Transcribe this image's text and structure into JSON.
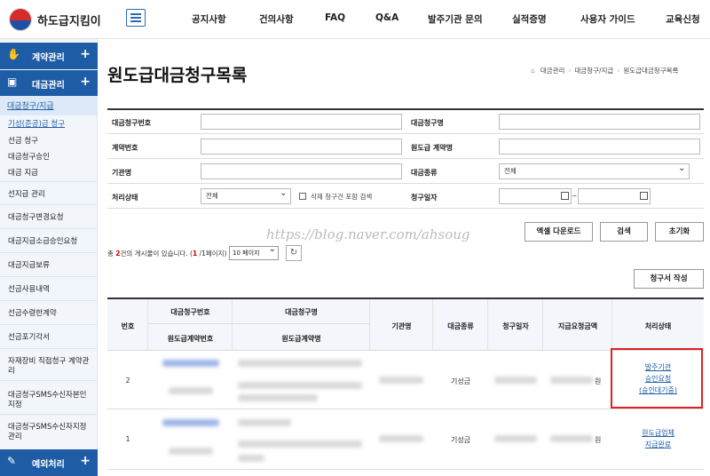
{
  "header": {
    "logo_text": "하도급지킴이",
    "nav": [
      "공지사항",
      "건의사항",
      "FAQ",
      "Q&A",
      "발주기관 문의",
      "실적증명",
      "사용자 가이드",
      "교육신청"
    ]
  },
  "sidebar": {
    "section1": "계약관리",
    "section2": "대금관리",
    "section3": "예외처리",
    "plus": "+",
    "sub_title": "대금청구/지급",
    "sub_items": [
      "기성(준공)금 청구",
      "선금 청구",
      "대금청구승인",
      "대금 지급"
    ],
    "menu_items": [
      "선지급 관리",
      "대금청구변경요청",
      "대금지급소급승인요청",
      "대금지급보류",
      "선금사용내역",
      "선금수령한계약",
      "선금포기각서",
      "자재장비 직접청구 계약관리",
      "대금청구SMS수신자본인지정",
      "대금청구SMS수신자지정관리"
    ]
  },
  "page": {
    "title": "원도급대금청구목록",
    "breadcrumb": [
      "대금관리",
      "대금청구/지급",
      "원도급대금청구목록"
    ]
  },
  "search": {
    "labels": [
      "대금청구번호",
      "대금청구명",
      "계약번호",
      "원도급 계약명",
      "기관명",
      "대금종류",
      "처리상태",
      "청구일자"
    ],
    "amount_type_value": "전체",
    "status_value": "전체",
    "include_deleted_label": "삭제 청구건 포함 검색",
    "date_sep": "~"
  },
  "buttons": {
    "excel": "엑셀 다운로드",
    "search": "검색",
    "reset": "초기화",
    "write": "청구서 작성"
  },
  "watermark": "https://blog.naver.com/ahsoug",
  "listinfo": {
    "prefix": "총 ",
    "count": "2",
    "middle": "건의 게시물이 있습니다. (",
    "page": "1",
    "suffix": " /1페이지)",
    "page_size": "10 페이지",
    "refresh_icon": "↻"
  },
  "table": {
    "headers": {
      "no": "번호",
      "claim_no": "대금청구번호",
      "contract_no": "원도급계약번호",
      "claim_name": "대금청구명",
      "contract_name": "원도급계약명",
      "org": "기관명",
      "type": "대금종류",
      "date": "청구일자",
      "amount": "지급요청금액",
      "status": "처리상태"
    },
    "rows": [
      {
        "no": "2",
        "type": "기성금",
        "won": "원",
        "status_lines": [
          "발주기관",
          "승인요청",
          "(승인대기중)"
        ]
      },
      {
        "no": "1",
        "type": "기성금",
        "won": "원",
        "status_lines": [
          "원도급업체",
          "지급완료"
        ]
      }
    ]
  }
}
